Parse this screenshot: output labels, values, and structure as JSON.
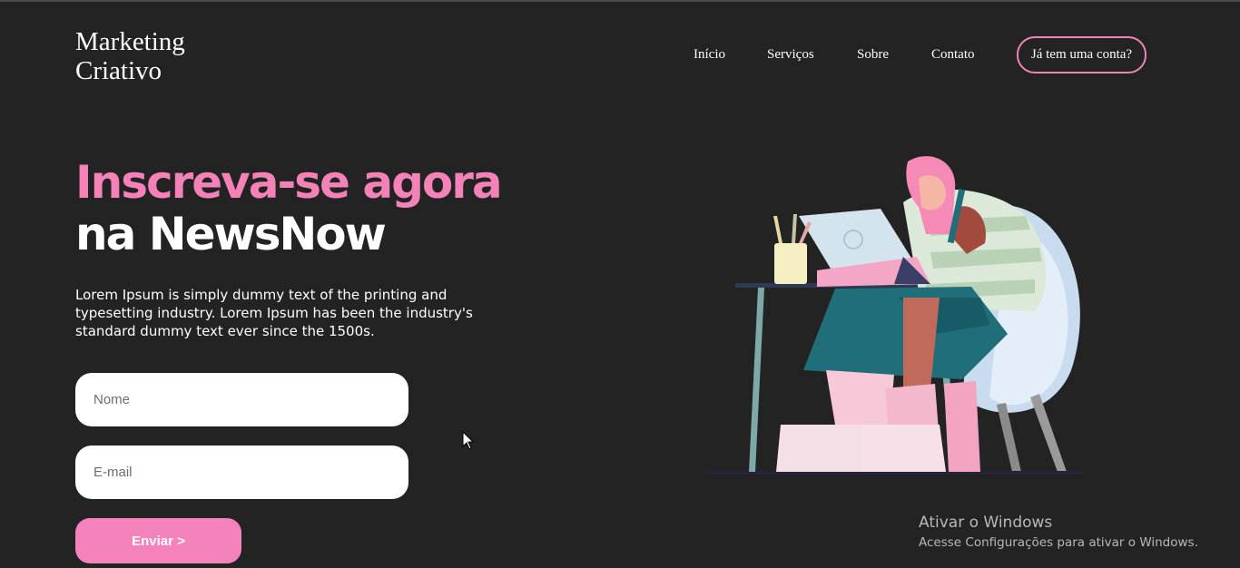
{
  "brand": {
    "line1": "Marketing",
    "line2": "Criativo"
  },
  "nav": {
    "items": [
      {
        "label": "Início"
      },
      {
        "label": "Serviços"
      },
      {
        "label": "Sobre"
      },
      {
        "label": "Contato"
      }
    ],
    "login_label": "Já tem uma conta?"
  },
  "hero": {
    "title_line1": "Inscreva-se agora",
    "title_line2": "na NewsNow",
    "description": "Lorem Ipsum is simply dummy text of the printing and typesetting industry. Lorem Ipsum has been the industry's standard dummy text ever since the 1500s."
  },
  "form": {
    "name": {
      "placeholder": "Nome",
      "value": ""
    },
    "email": {
      "placeholder": "E-mail",
      "value": ""
    },
    "submit_label": "Enviar >"
  },
  "watermark": {
    "title": "Ativar o Windows",
    "subtitle": "Acesse Configurações para ativar o Windows."
  },
  "colors": {
    "background": "#232323",
    "accent_pink": "#f482b8",
    "button_pink": "#f583bb",
    "text": "#ffffff"
  },
  "illustration": {
    "icon": "woman-at-laptop-illustration"
  }
}
